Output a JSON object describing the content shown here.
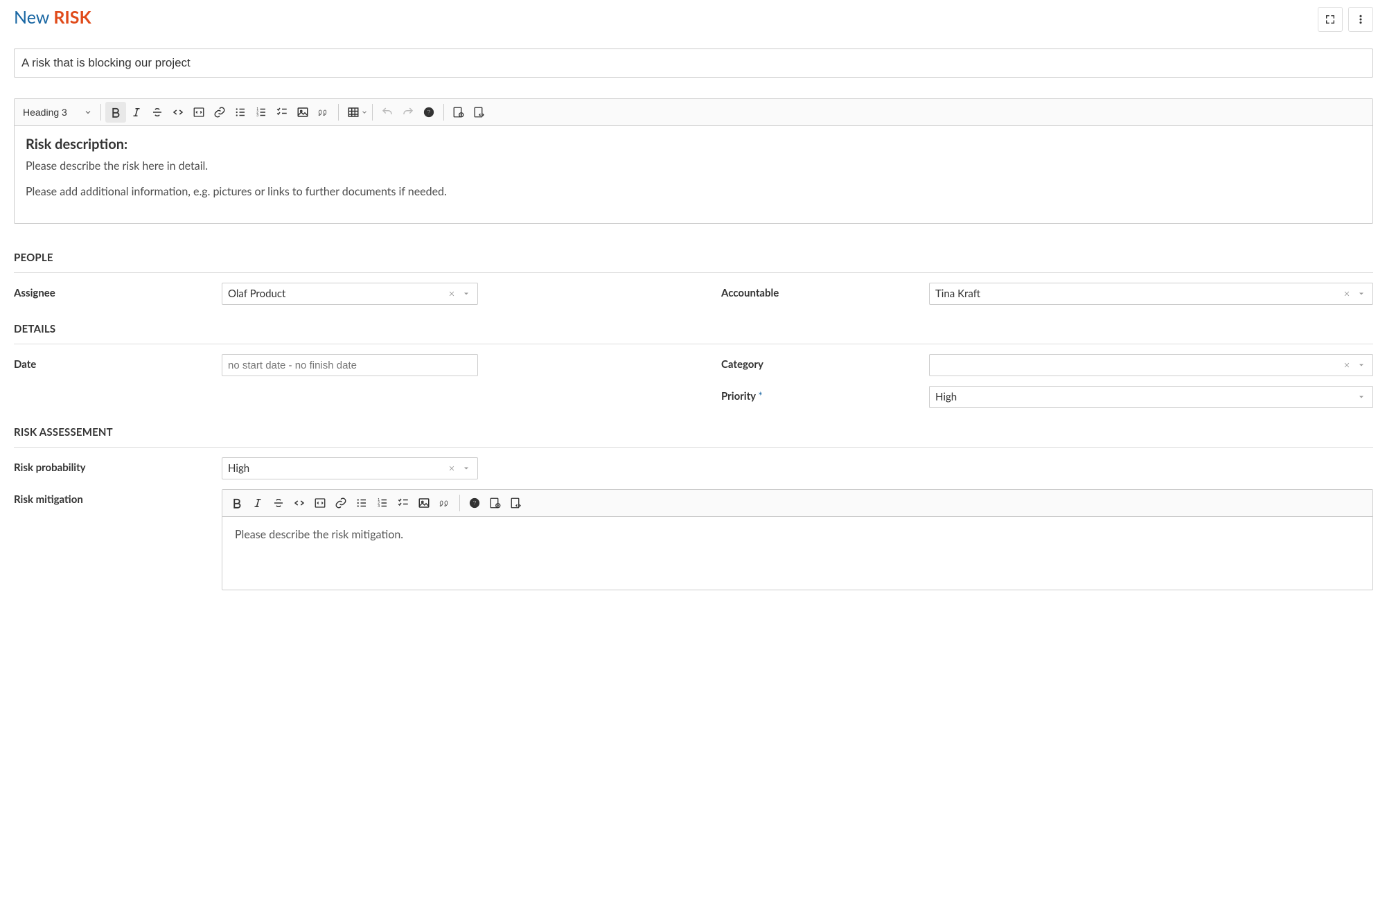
{
  "header": {
    "new_label": "New",
    "type_label": "RISK"
  },
  "title_input": {
    "value": "A risk that is blocking our project"
  },
  "main_editor": {
    "heading_select": "Heading 3",
    "content_heading": "Risk description:",
    "content_line1": "Please describe the risk here in detail.",
    "content_line2": "Please add additional information, e.g. pictures or links to further documents if needed."
  },
  "sections": {
    "people": {
      "title": "PEOPLE",
      "assignee_label": "Assignee",
      "assignee_value": "Olaf Product",
      "accountable_label": "Accountable",
      "accountable_value": "Tina Kraft"
    },
    "details": {
      "title": "DETAILS",
      "date_label": "Date",
      "date_value": "no start date - no finish date",
      "category_label": "Category",
      "category_value": "",
      "priority_label": "Priority",
      "priority_required": "*",
      "priority_value": "High"
    },
    "risk": {
      "title": "RISK ASSESSEMENT",
      "probability_label": "Risk probability",
      "probability_value": "High",
      "mitigation_label": "Risk mitigation",
      "mitigation_placeholder": "Please describe the risk mitigation."
    }
  }
}
